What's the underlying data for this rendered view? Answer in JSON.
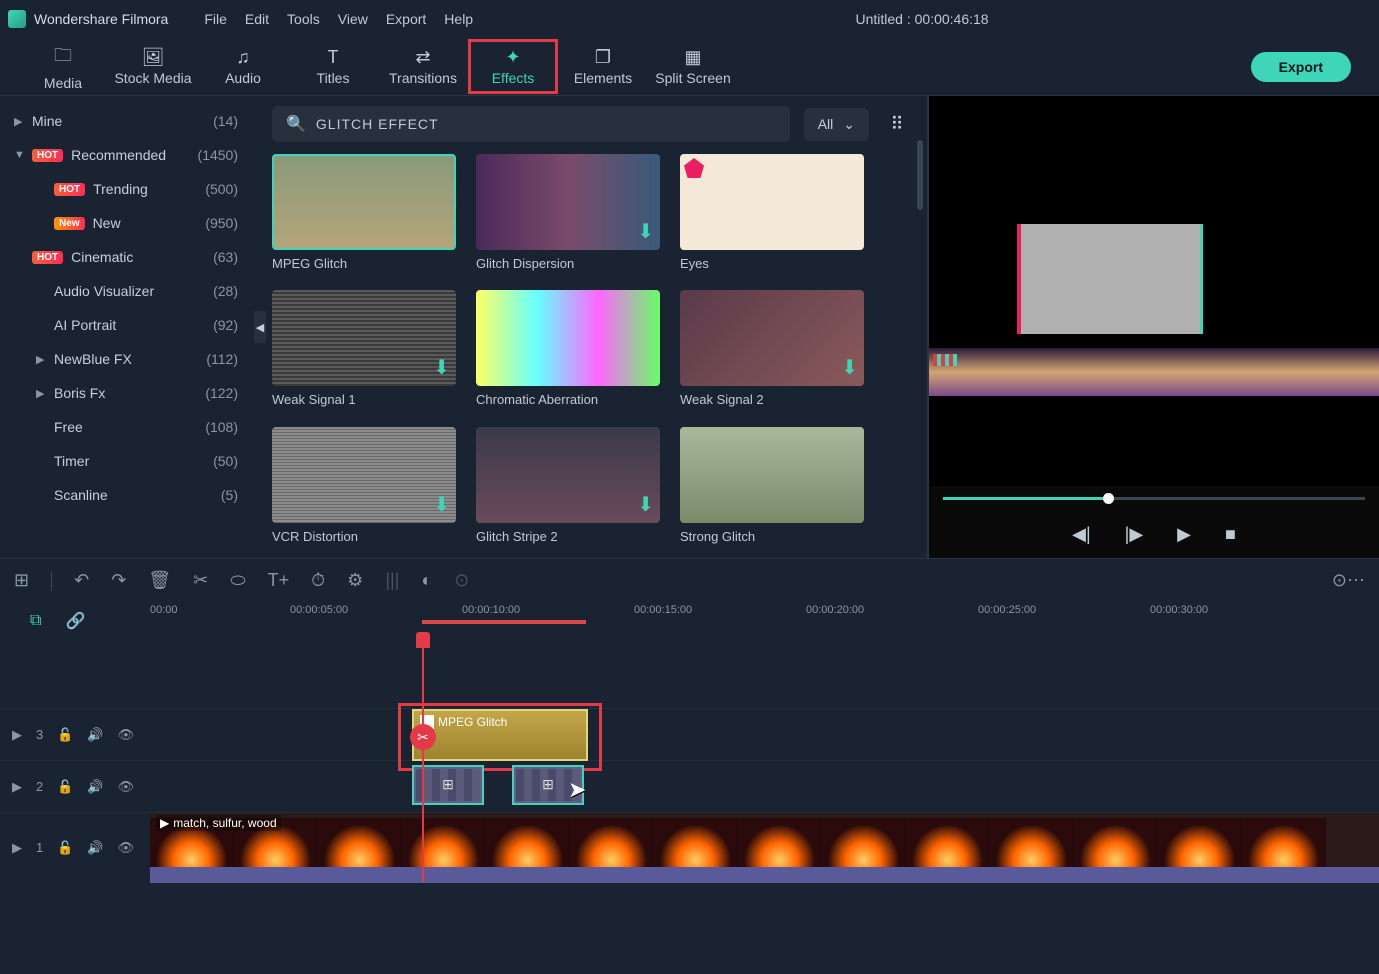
{
  "app": {
    "name": "Wondershare Filmora",
    "title": "Untitled : 00:00:46:18"
  },
  "menu": [
    "File",
    "Edit",
    "Tools",
    "View",
    "Export",
    "Help"
  ],
  "tabs": [
    {
      "label": "Media",
      "icon": "🗀"
    },
    {
      "label": "Stock Media",
      "icon": "🖼"
    },
    {
      "label": "Audio",
      "icon": "♫"
    },
    {
      "label": "Titles",
      "icon": "T"
    },
    {
      "label": "Transitions",
      "icon": "⇄"
    },
    {
      "label": "Effects",
      "icon": "✦",
      "active": true,
      "highlighted": true
    },
    {
      "label": "Elements",
      "icon": "❐"
    },
    {
      "label": "Split Screen",
      "icon": "▦"
    }
  ],
  "export_label": "Export",
  "sidebar": [
    {
      "label": "Mine",
      "count": "(14)",
      "arrow": "▶"
    },
    {
      "label": "Recommended",
      "count": "(1450)",
      "arrow": "▼",
      "badge": "HOT"
    },
    {
      "label": "Trending",
      "count": "(500)",
      "child": true,
      "badge": "HOT"
    },
    {
      "label": "New",
      "count": "(950)",
      "child": true,
      "badge": "New"
    },
    {
      "label": "Cinematic",
      "count": "(63)",
      "badge": "HOT"
    },
    {
      "label": "Audio Visualizer",
      "count": "(28)",
      "child": true
    },
    {
      "label": "AI Portrait",
      "count": "(92)",
      "child": true
    },
    {
      "label": "NewBlue FX",
      "count": "(112)",
      "arrow": "▶",
      "child": true
    },
    {
      "label": "Boris Fx",
      "count": "(122)",
      "arrow": "▶",
      "child": true
    },
    {
      "label": "Free",
      "count": "(108)",
      "child": true
    },
    {
      "label": "Timer",
      "count": "(50)",
      "child": true
    },
    {
      "label": "Scanline",
      "count": "(5)",
      "child": true
    }
  ],
  "search": {
    "value": "GLITCH EFFECT",
    "filter": "All"
  },
  "effects": [
    {
      "label": "MPEG Glitch",
      "selected": true
    },
    {
      "label": "Glitch Dispersion",
      "download": true
    },
    {
      "label": "Eyes",
      "premium": true
    },
    {
      "label": "Weak Signal 1",
      "download": true
    },
    {
      "label": "Chromatic Aberration"
    },
    {
      "label": "Weak Signal 2",
      "download": true
    },
    {
      "label": "VCR Distortion",
      "download": true
    },
    {
      "label": "Glitch Stripe 2",
      "download": true
    },
    {
      "label": "Strong Glitch"
    }
  ],
  "ruler": [
    "00:00",
    "00:00:05:00",
    "00:00:10:00",
    "00:00:15:00",
    "00:00:20:00",
    "00:00:25:00",
    "00:00:30:00"
  ],
  "tracks": {
    "t3": "3",
    "t2": "2",
    "t1": "1"
  },
  "clips": {
    "effect": "MPEG Glitch",
    "video": "match, sulfur, wood"
  }
}
